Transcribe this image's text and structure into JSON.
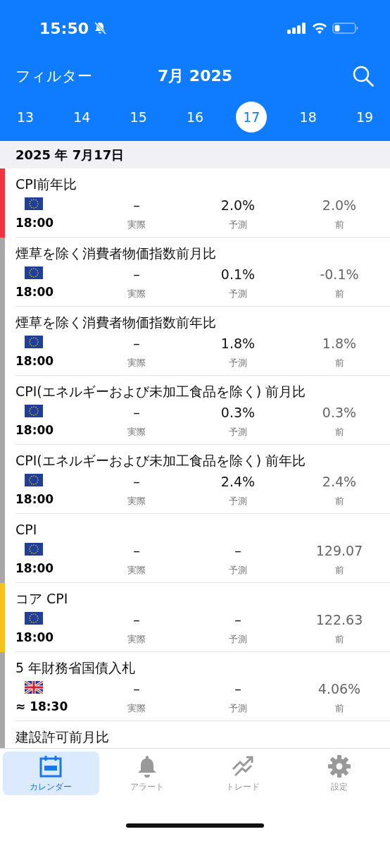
{
  "status_bar": {
    "time": "15:50",
    "silent": true
  },
  "header": {
    "filter": "フィルター",
    "month": "7月 2025"
  },
  "dates": [
    {
      "label": "13",
      "selected": false
    },
    {
      "label": "14",
      "selected": false
    },
    {
      "label": "15",
      "selected": false
    },
    {
      "label": "16",
      "selected": false
    },
    {
      "label": "17",
      "selected": true
    },
    {
      "label": "18",
      "selected": false
    },
    {
      "label": "19",
      "selected": false
    }
  ],
  "section_date": "2025 年 7月17日",
  "events": [
    {
      "title": "CPI前年比",
      "color": "#f0333f",
      "kind": "eu",
      "time": "18:00",
      "actual": "–",
      "actual_label": "実際",
      "forecast": "2.0%",
      "forecast_label": "予測",
      "previous": "2.0%",
      "previous_label": "前"
    },
    {
      "title": "煙草を除く消費者物価指数前月比",
      "color": "#a8a8a8",
      "kind": "eu",
      "time": "18:00",
      "actual": "–",
      "actual_label": "実際",
      "forecast": "0.1%",
      "forecast_label": "予測",
      "previous": "-0.1%",
      "previous_label": "前"
    },
    {
      "title": "煙草を除く消費者物価指数前年比",
      "color": "#a8a8a8",
      "kind": "eu",
      "time": "18:00",
      "actual": "–",
      "actual_label": "実際",
      "forecast": "1.8%",
      "forecast_label": "予測",
      "previous": "1.8%",
      "previous_label": "前"
    },
    {
      "title": "CPI(エネルギーおよび未加工食品を除く) 前月比",
      "color": "#a8a8a8",
      "kind": "eu",
      "time": "18:00",
      "actual": "–",
      "actual_label": "実際",
      "forecast": "0.3%",
      "forecast_label": "予測",
      "previous": "0.3%",
      "previous_label": "前"
    },
    {
      "title": "CPI(エネルギーおよび未加工食品を除く) 前年比",
      "color": "#a8a8a8",
      "kind": "eu",
      "time": "18:00",
      "actual": "–",
      "actual_label": "実際",
      "forecast": "2.4%",
      "forecast_label": "予測",
      "previous": "2.4%",
      "previous_label": "前"
    },
    {
      "title": "CPI",
      "color": "#a8a8a8",
      "kind": "eu",
      "time": "18:00",
      "actual": "–",
      "actual_label": "実際",
      "forecast": "–",
      "forecast_label": "予測",
      "previous": "129.07",
      "previous_label": "前"
    },
    {
      "title": "コア CPI",
      "color": "#f8c21c",
      "kind": "eu",
      "time": "18:00",
      "actual": "–",
      "actual_label": "実際",
      "forecast": "–",
      "forecast_label": "予測",
      "previous": "122.63",
      "previous_label": "前"
    },
    {
      "title": "5 年財務省国債入札",
      "color": "#a8a8a8",
      "kind": "uk",
      "time": "≈ 18:30",
      "actual": "–",
      "actual_label": "実際",
      "forecast": "–",
      "forecast_label": "予測",
      "previous": "4.06%",
      "previous_label": "前"
    },
    {
      "title": "建設許可前月比",
      "color": "#a8a8a8"
    }
  ],
  "tabs": [
    {
      "label": "カレンダー",
      "kind": "calendar",
      "selected": true
    },
    {
      "label": "アラート",
      "kind": "bell",
      "selected": false
    },
    {
      "label": "トレード",
      "kind": "trend",
      "selected": false
    },
    {
      "label": "設定",
      "kind": "gear",
      "selected": false
    }
  ]
}
